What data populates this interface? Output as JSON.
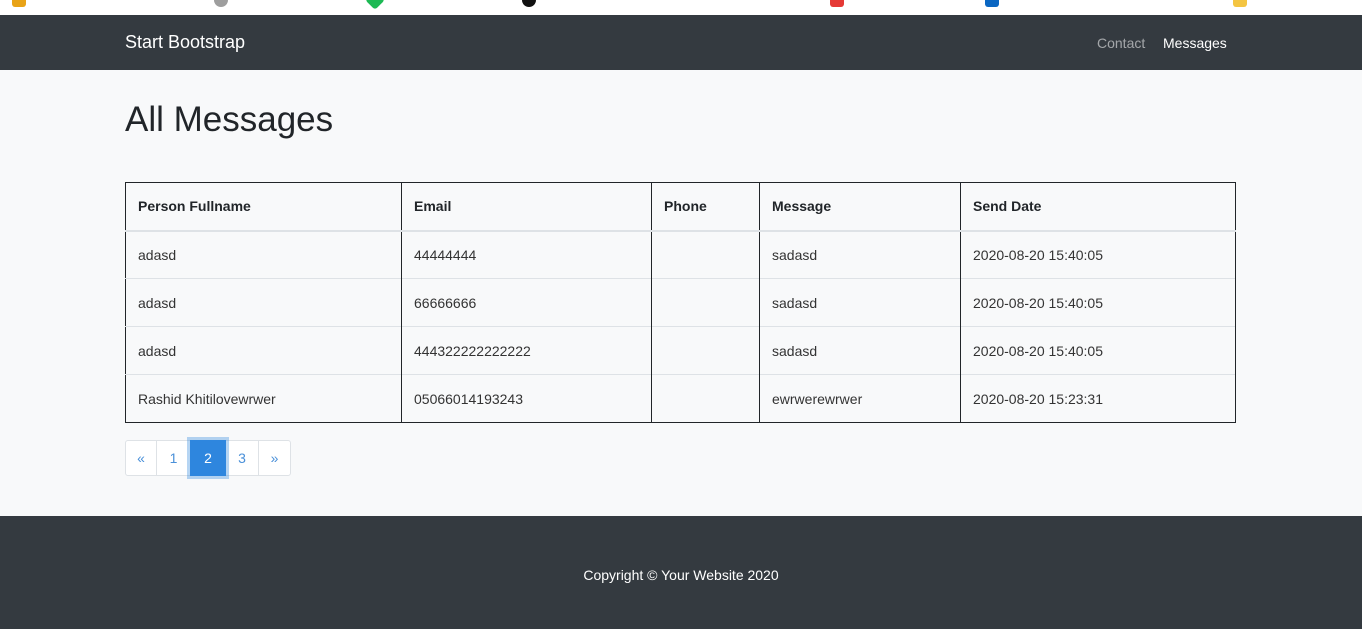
{
  "navbar": {
    "brand": "Start Bootstrap",
    "links": [
      {
        "label": "Contact",
        "active": false
      },
      {
        "label": "Messages",
        "active": true
      }
    ]
  },
  "main": {
    "title": "All Messages",
    "table": {
      "headers": [
        "Person Fullname",
        "Email",
        "Phone",
        "Message",
        "Send Date"
      ],
      "rows": [
        [
          "adasd",
          "44444444",
          "",
          "sadasd",
          "2020-08-20 15:40:05"
        ],
        [
          "adasd",
          "66666666",
          "",
          "sadasd",
          "2020-08-20 15:40:05"
        ],
        [
          "adasd",
          "444322222222222",
          "",
          "sadasd",
          "2020-08-20 15:40:05"
        ],
        [
          "Rashid Khitilovewrwer",
          "05066014193243",
          "",
          "ewrwerewrwer",
          "2020-08-20 15:23:31"
        ]
      ]
    },
    "pagination": {
      "prev": "«",
      "pages": [
        "1",
        "2",
        "3"
      ],
      "active_page": "2",
      "next": "»"
    }
  },
  "footer": {
    "copyright": "Copyright © Your Website 2020"
  },
  "colors": {
    "navbar_bg": "#343a40",
    "page_bg": "#f8f9fa",
    "link": "#4a90d9",
    "active_page": "#2e86de"
  }
}
